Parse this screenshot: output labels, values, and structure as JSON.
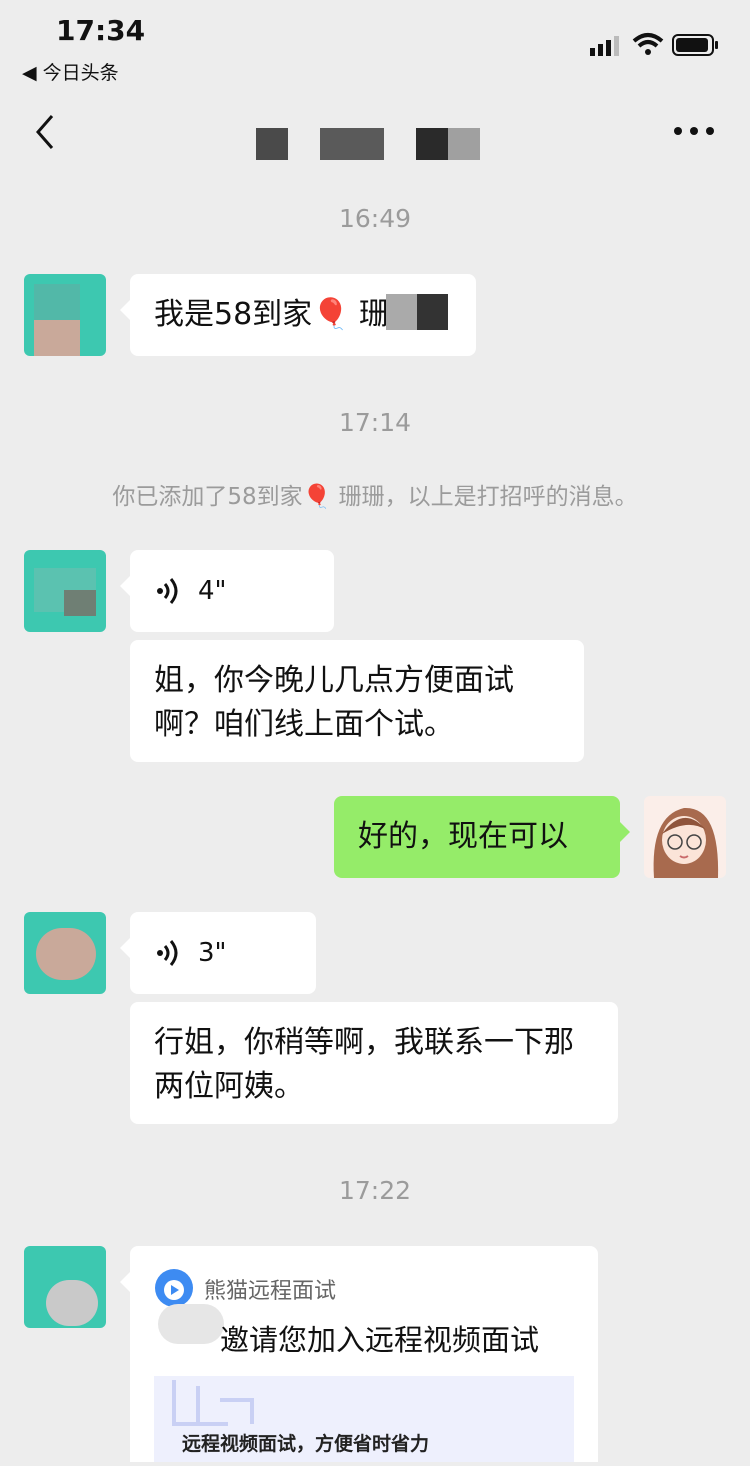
{
  "status": {
    "time": "17:34",
    "back_app": "今日头条"
  },
  "header": {
    "title_redacted": true
  },
  "messages": {
    "ts1": "16:49",
    "greeting": "我是58到家🎈 珊",
    "ts2": "17:14",
    "system_notice": "你已添加了58到家🎈 珊珊，以上是打招呼的消息。",
    "voice1": "4\"",
    "text1": "姐，你今晚儿几点方便面试啊？咱们线上面个试。",
    "reply": "好的，现在可以",
    "voice2": "3\"",
    "text2": "行姐，你稍等啊，我联系一下那两位阿姨。",
    "ts3": "17:22",
    "card_app": "熊猫远程面试",
    "card_title": "邀请您加入远程视频面试",
    "card_banner": "远程视频面试，方便省时省力"
  },
  "colors": {
    "background": "#ededed",
    "bubble_in": "#ffffff",
    "bubble_out": "#95ec69",
    "accent": "#3dc8b0"
  },
  "icons": [
    "signal-icon",
    "wifi-icon",
    "battery-icon",
    "back-arrow-icon",
    "more-icon",
    "voice-icon"
  ]
}
